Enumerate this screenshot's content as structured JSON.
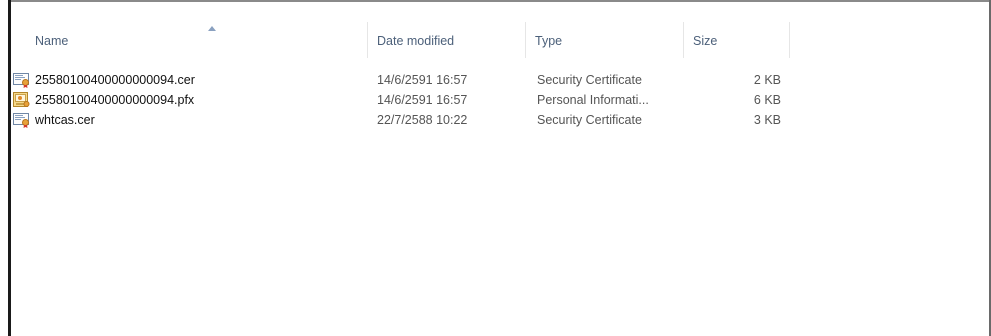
{
  "columns": {
    "name": "Name",
    "date_modified": "Date modified",
    "type": "Type",
    "size": "Size"
  },
  "files": [
    {
      "name": "25580100400000000094.cer",
      "date_modified": "14/6/2591 16:57",
      "type": "Security Certificate",
      "size": "2 KB",
      "icon": "certificate-icon"
    },
    {
      "name": "25580100400000000094.pfx",
      "date_modified": "14/6/2591 16:57",
      "type": "Personal Informati...",
      "size": "6 KB",
      "icon": "personal-information-exchange-icon"
    },
    {
      "name": "whtcas.cer",
      "date_modified": "22/7/2588 10:22",
      "type": "Security Certificate",
      "size": "3 KB",
      "icon": "certificate-icon"
    }
  ],
  "sort": {
    "column": "name",
    "direction": "ascending"
  },
  "colors": {
    "header_text": "#4c607a",
    "divider": "#e6e6e6",
    "sort_arrow": "#8aa1c0"
  }
}
